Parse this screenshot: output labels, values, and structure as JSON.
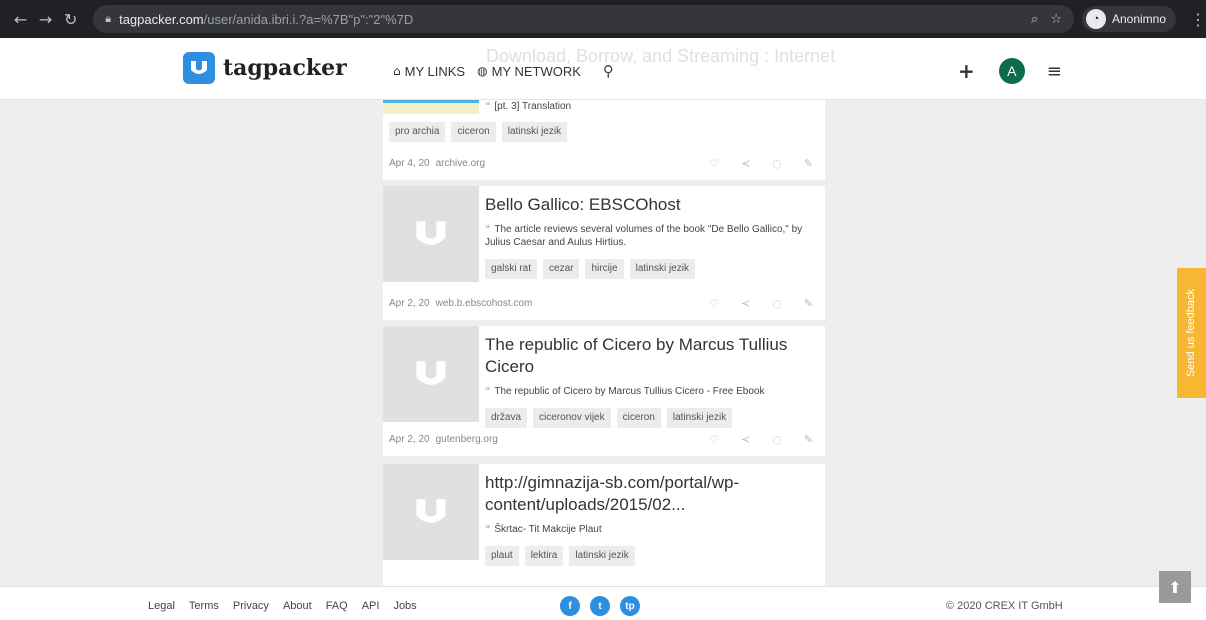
{
  "browser": {
    "url_host": "tagpacker.com",
    "url_path": "/user/anida.ibri.i.?a=%7B\"p\":\"2\"%7D",
    "profile_name": "Anonimno"
  },
  "header": {
    "logo_text": "tagpacker",
    "nav": [
      {
        "label": "MY LINKS",
        "icon": "home-icon"
      },
      {
        "label": "MY NETWORK",
        "icon": "globe-icon"
      }
    ],
    "ghost_title": "Download, Borrow, and Streaming : Internet",
    "avatar_letter": "A"
  },
  "first_card": {
    "desc": "[pt. 3] Translation",
    "tags": [
      "pro archia",
      "ciceron",
      "latinski jezik"
    ],
    "date": "Apr 4, 20",
    "domain": "archive.org"
  },
  "cards": [
    {
      "title": "Bello Gallico: EBSCOhost",
      "desc": "The article reviews several volumes of the book \"De Bello Gallico,\" by Julius Caesar and Aulus Hirtius.",
      "tags": [
        "galski rat",
        "cezar",
        "hircije",
        "latinski jezik"
      ],
      "date": "Apr 2, 20",
      "domain": "web.b.ebscohost.com"
    },
    {
      "title": "The republic of Cicero by Marcus Tullius Cicero",
      "desc": "The republic of Cicero by Marcus Tullius Cicero - Free Ebook",
      "tags": [
        "država",
        "ciceronov vijek",
        "ciceron",
        "latinski jezik"
      ],
      "date": "Apr 2, 20",
      "domain": "gutenberg.org"
    },
    {
      "title": "http://gimnazija-sb.com/portal/wp-content/uploads/2015/02...",
      "desc": "Škrtac- Tit Makcije Plaut",
      "tags": [
        "plaut",
        "lektira",
        "latinski jezik"
      ],
      "date": "",
      "domain": ""
    }
  ],
  "footer": {
    "links": [
      "Legal",
      "Terms",
      "Privacy",
      "About",
      "FAQ",
      "API",
      "Jobs"
    ],
    "socials": [
      "f",
      "t",
      "tp"
    ],
    "copyright": "© 2020 CREX IT GmbH"
  },
  "feedback": "Send us feedback"
}
